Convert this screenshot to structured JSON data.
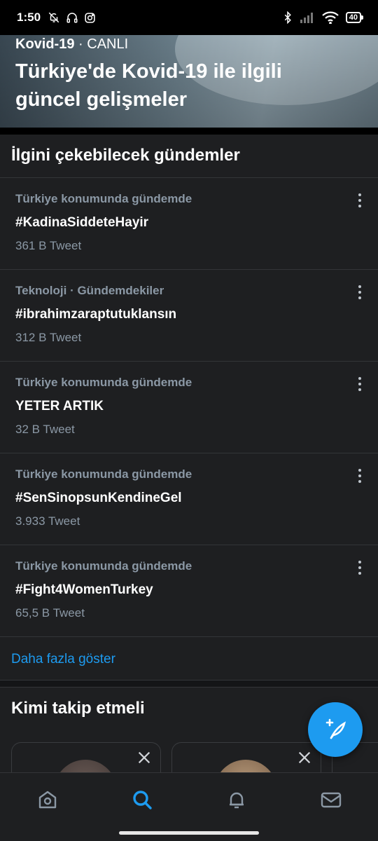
{
  "status_bar": {
    "time": "1:50",
    "battery": "40",
    "icons_left": [
      "muted-bell-icon",
      "headphones-icon",
      "instagram-icon"
    ],
    "icons_right": [
      "bluetooth-icon",
      "signal-icon",
      "wifi-icon",
      "battery-icon"
    ]
  },
  "hero": {
    "topic": "Kovid-19",
    "separator": " · ",
    "live": "CANLI",
    "title": "Türkiye'de Kovid-19 ile ilgili güncel gelişmeler"
  },
  "trends_section": {
    "title": "İlgini çekebilecek gündemler",
    "items": [
      {
        "context": "Türkiye konumunda gündemde",
        "name": "#KadinaSiddeteHayir",
        "count": "361 B Tweet"
      },
      {
        "context": "Teknoloji · Gündemdekiler",
        "name": "#ibrahimzaraptutuklansın",
        "count": "312 B Tweet"
      },
      {
        "context": "Türkiye konumunda gündemde",
        "name": "YETER ARTIK",
        "count": "32 B Tweet"
      },
      {
        "context": "Türkiye konumunda gündemde",
        "name": "#SenSinopsunKendineGel",
        "count": "3.933 Tweet"
      },
      {
        "context": "Türkiye konumunda gündemde",
        "name": "#Fight4WomenTurkey",
        "count": "65,5 B Tweet"
      }
    ],
    "show_more": "Daha fazla göster"
  },
  "follow_section": {
    "title": "Kimi takip etmeli"
  },
  "bottom_nav": {
    "items": [
      "home-icon",
      "search-icon",
      "notifications-icon",
      "messages-icon"
    ],
    "active": "search-icon"
  },
  "colors": {
    "accent": "#1d9bf0",
    "background": "#1e1f21",
    "secondary_text": "#8b98a5"
  }
}
